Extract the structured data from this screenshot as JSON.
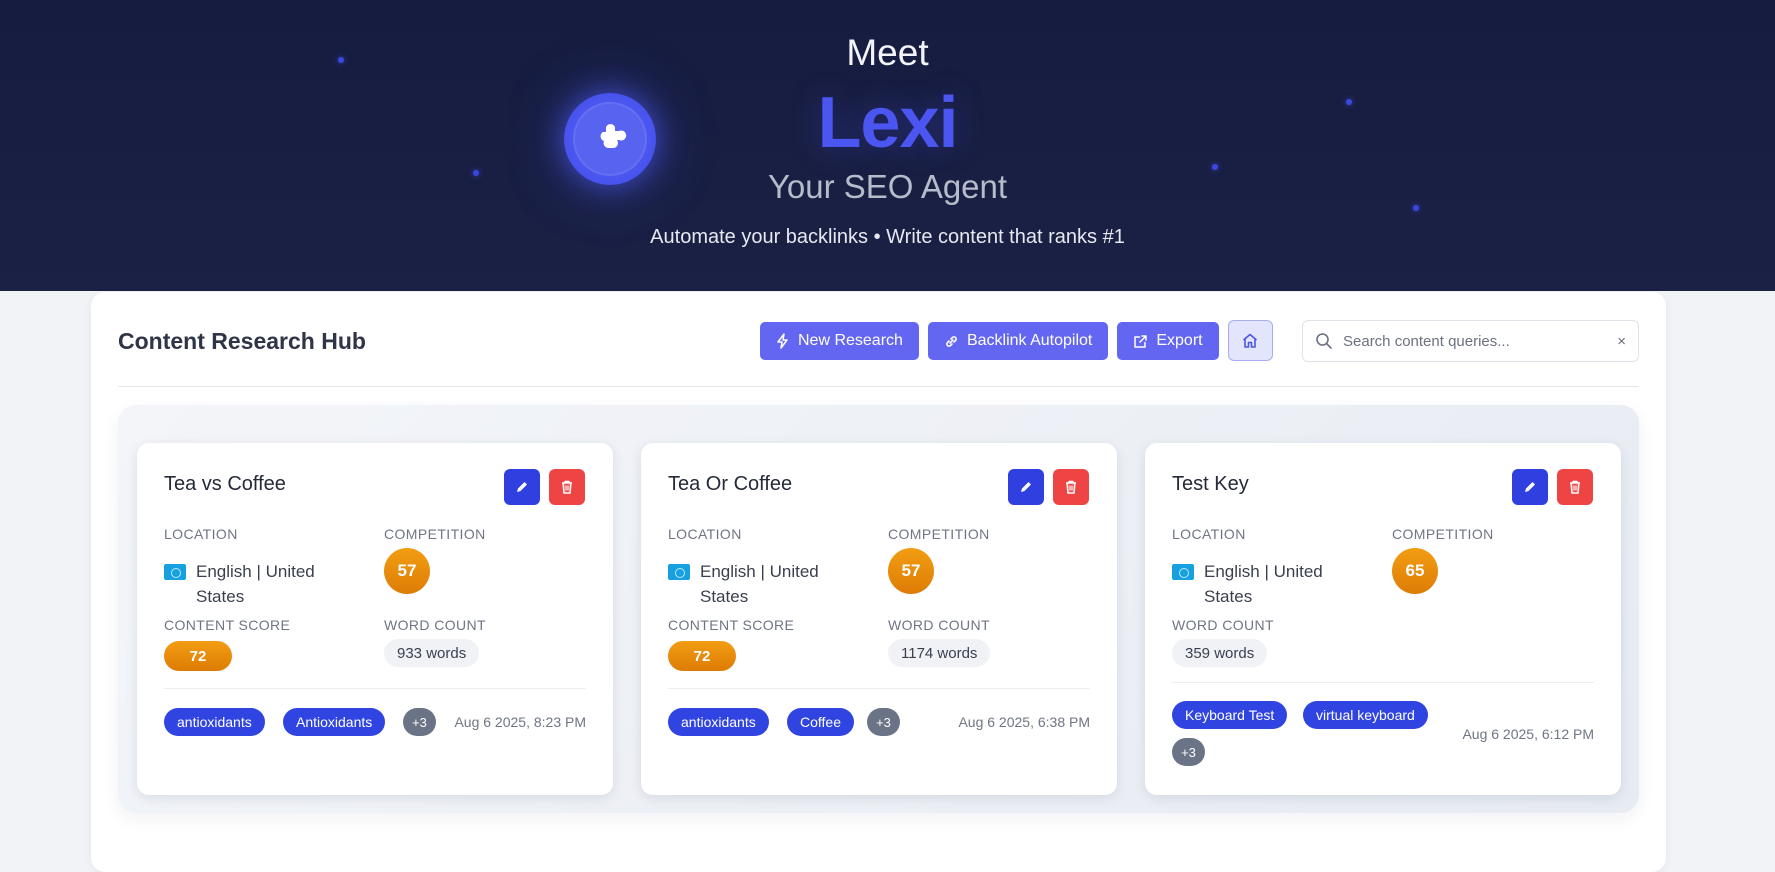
{
  "hero": {
    "meet": "Meet",
    "name": "Lexi",
    "subtitle": "Your SEO Agent",
    "tagline": "Automate your backlinks • Write content that ranks #1",
    "logo_icon": "puzzle-icon",
    "accent": "#4b55f0"
  },
  "panel": {
    "title": "Content Research Hub",
    "toolbar": {
      "new_research": "New Research",
      "backlink_autopilot": "Backlink Autopilot",
      "export": "Export",
      "home_icon": "home-icon"
    },
    "search": {
      "placeholder": "Search content queries...",
      "value": "",
      "clear": "×"
    }
  },
  "labels": {
    "location": "LOCATION",
    "competition": "COMPETITION",
    "content_score": "CONTENT SCORE",
    "word_count": "WORD COUNT"
  },
  "cards": [
    {
      "title": "Tea vs Coffee",
      "location_line1": "English | United",
      "location_line2": "States",
      "competition": "57",
      "content_score": "72",
      "word_count": "933 words",
      "tags": [
        "antioxidants",
        "Antioxidants"
      ],
      "more": "+3",
      "date": "Aug 6 2025, 8:23 PM"
    },
    {
      "title": "Tea Or Coffee",
      "location_line1": "English | United",
      "location_line2": "States",
      "competition": "57",
      "content_score": "72",
      "word_count": "1174 words",
      "tags": [
        "antioxidants",
        "Coffee"
      ],
      "more": "+3",
      "date": "Aug 6 2025, 6:38 PM"
    },
    {
      "title": "Test Key",
      "location_line1": "English | United",
      "location_line2": "States",
      "competition": "65",
      "word_count": "359 words",
      "tags": [
        "Keyboard Test",
        "virtual keyboard"
      ],
      "more": "+3",
      "date": "Aug 6 2025, 6:12 PM"
    }
  ],
  "colors": {
    "primary_button": "#6366f1",
    "edit": "#2f3fe0",
    "delete": "#ef4444",
    "score_orange": "#f29d12",
    "tag_blue": "#3044e2"
  }
}
